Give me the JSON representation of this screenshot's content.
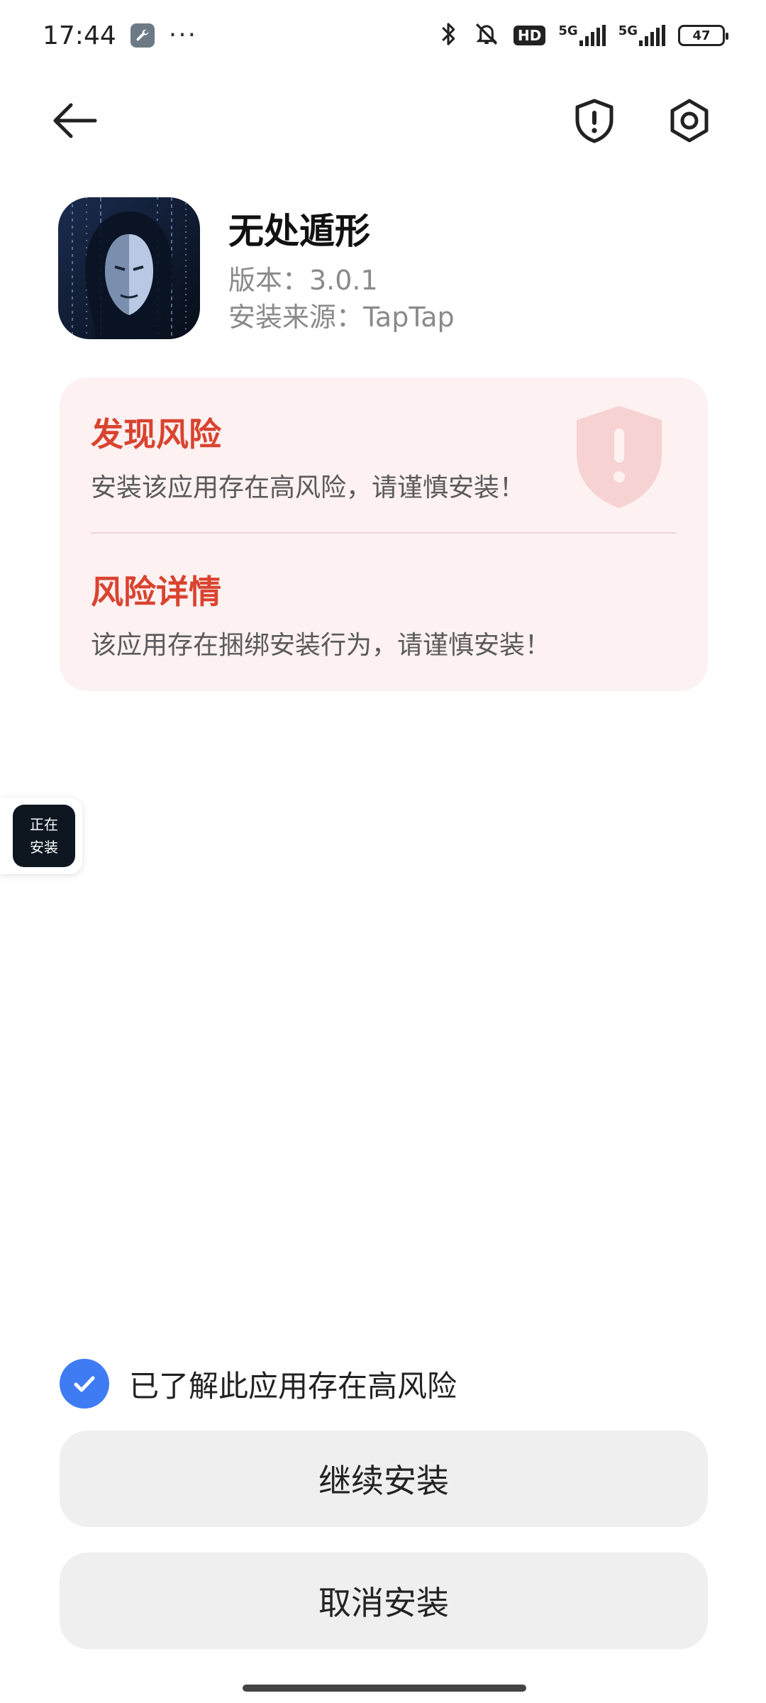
{
  "status_bar": {
    "time": "17:44",
    "more": "···",
    "hd": "HD",
    "network_1": "5G",
    "network_2": "5G",
    "battery": "47"
  },
  "app": {
    "name": "无处遁形",
    "version": "版本：3.0.1",
    "source": "安装来源：TapTap"
  },
  "risk": {
    "title": "发现风险",
    "desc": "安装该应用存在高风险，请谨慎安装！",
    "detail_title": "风险详情",
    "detail_desc": "该应用存在捆绑安装行为，请谨慎安装！"
  },
  "floating_badge": {
    "line1": "正在",
    "line2": "安装"
  },
  "ack": {
    "label": "已了解此应用存在高风险",
    "checked": true
  },
  "buttons": {
    "continue": "继续安装",
    "cancel": "取消安装"
  },
  "colors": {
    "accent_red": "#d9432f",
    "card_bg": "#fdf1f1",
    "check_blue": "#3f7cf3",
    "button_bg": "#efefef"
  }
}
